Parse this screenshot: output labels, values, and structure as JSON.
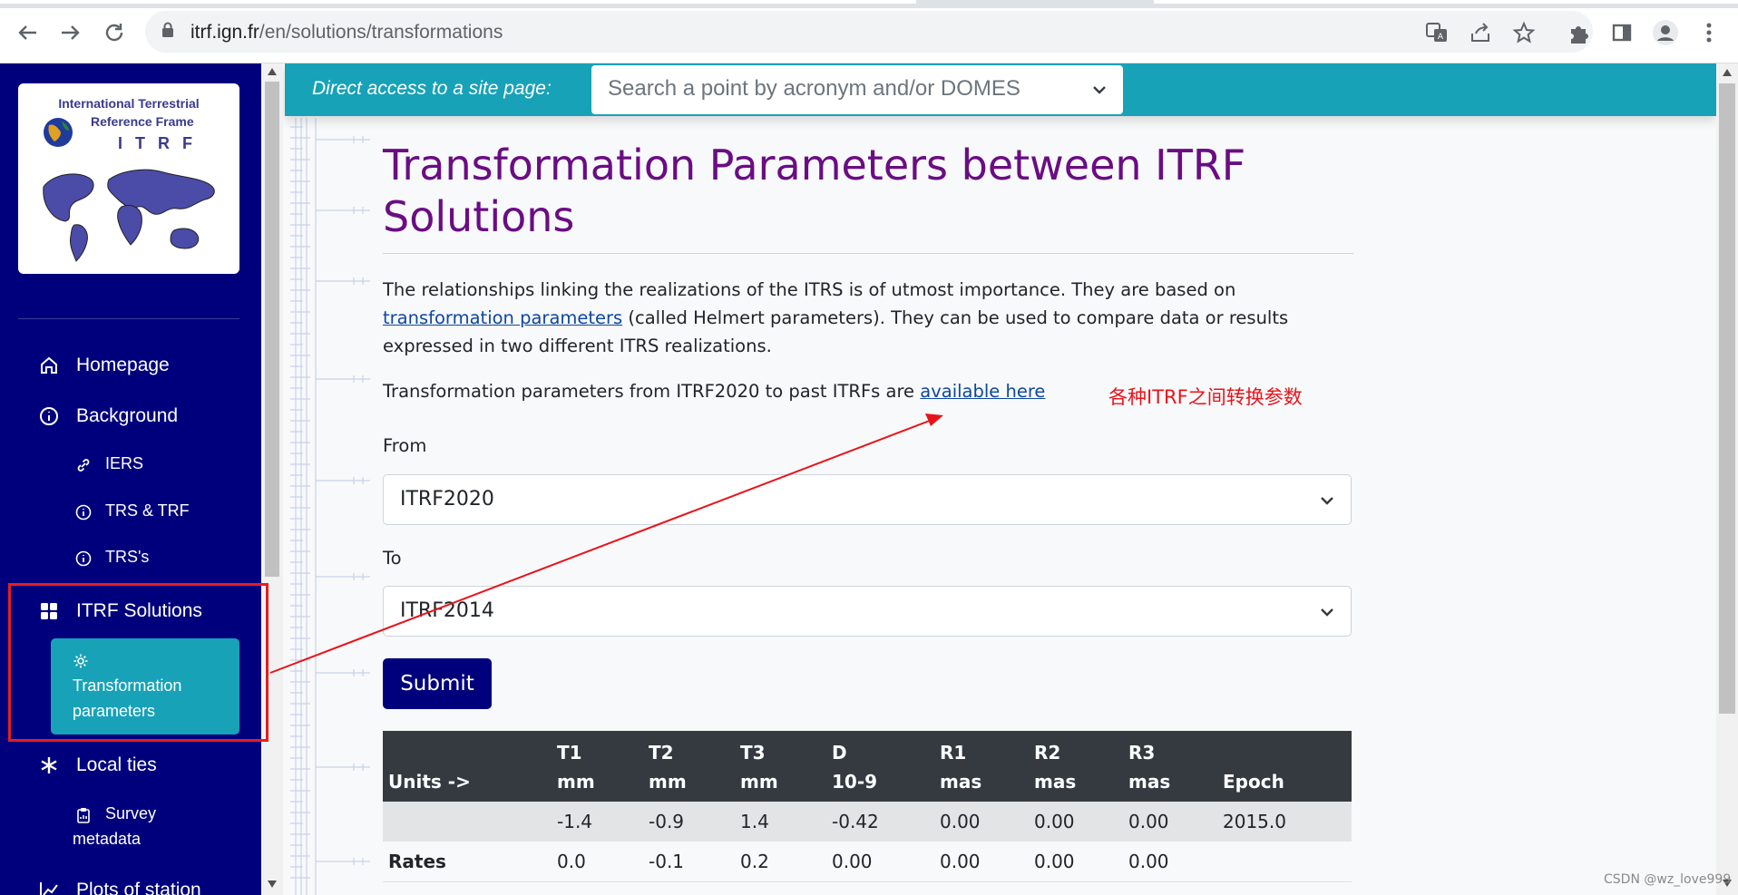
{
  "browser": {
    "url_host": "itrf.ign.fr",
    "url_path": "/en/solutions/transformations",
    "icons": [
      "back-icon",
      "forward-icon",
      "reload-icon",
      "lock-icon",
      "translate-icon",
      "share-icon",
      "star-icon",
      "extensions-icon",
      "sidepanel-icon",
      "profile-icon",
      "menu-icon"
    ]
  },
  "logo": {
    "line1": "International Terrestrial",
    "line2": "Reference Frame",
    "line3": "ITRF"
  },
  "sidebar": {
    "items": [
      {
        "label": "Homepage",
        "icon": "home-icon"
      },
      {
        "label": "Background",
        "icon": "info-icon"
      },
      {
        "label": "IERS",
        "icon": "link-icon"
      },
      {
        "label": "TRS & TRF",
        "icon": "info-icon"
      },
      {
        "label": "TRS's",
        "icon": "info-icon"
      },
      {
        "label": "ITRF Solutions",
        "icon": "grid-icon"
      },
      {
        "label": "Transformation parameters",
        "line1": "Transformation",
        "line2": "parameters",
        "icon": "gear-icon"
      },
      {
        "label": "Local ties",
        "icon": "asterisk-icon"
      },
      {
        "label": "Survey metadata",
        "line1": "Survey",
        "line2": "metadata",
        "icon": "clipboard-icon"
      },
      {
        "label": "Plots of station",
        "icon": "chart-icon"
      }
    ]
  },
  "banner": {
    "label": "Direct access to a site page:",
    "placeholder": "Search a point by acronym and/or DOMES"
  },
  "page": {
    "title": "Transformation Parameters between ITRF Solutions",
    "p1_before": "The relationships linking the realizations of the ITRS is of utmost importance. They are based on ",
    "p1_link": "transformation parameters",
    "p1_after": " (called Helmert parameters). They can be used to compare data or results expressed in two different ITRS realizations.",
    "p2_before": "Transformation parameters from ITRF2020 to past ITRFs are ",
    "p2_link": "available here",
    "from_label": "From",
    "from_value": "ITRF2020",
    "to_label": "To",
    "to_value": "ITRF2014",
    "submit": "Submit"
  },
  "table": {
    "headers": [
      {
        "l1": "",
        "l2": "Units ->"
      },
      {
        "l1": "T1",
        "l2": "mm"
      },
      {
        "l1": "T2",
        "l2": "mm"
      },
      {
        "l1": "T3",
        "l2": "mm"
      },
      {
        "l1": "D",
        "l2": "10-9"
      },
      {
        "l1": "R1",
        "l2": "mas"
      },
      {
        "l1": "R2",
        "l2": "mas"
      },
      {
        "l1": "R3",
        "l2": "mas"
      },
      {
        "l1": "Epoch",
        "l2": ""
      }
    ],
    "rows": [
      [
        "",
        "-1.4",
        "-0.9",
        "1.4",
        "-0.42",
        "0.00",
        "0.00",
        "0.00",
        "2015.0"
      ],
      [
        "Rates",
        "0.0",
        "-0.1",
        "0.2",
        "0.00",
        "0.00",
        "0.00",
        "0.00",
        ""
      ]
    ]
  },
  "annotation": "各种ITRF之间转换参数",
  "watermark": "CSDN @wz_love999",
  "colors": {
    "sidebar": "#00007d",
    "accent": "#17a2b8",
    "title": "#6a0d83",
    "annotation": "#e8141a",
    "table_header": "#343a40"
  }
}
